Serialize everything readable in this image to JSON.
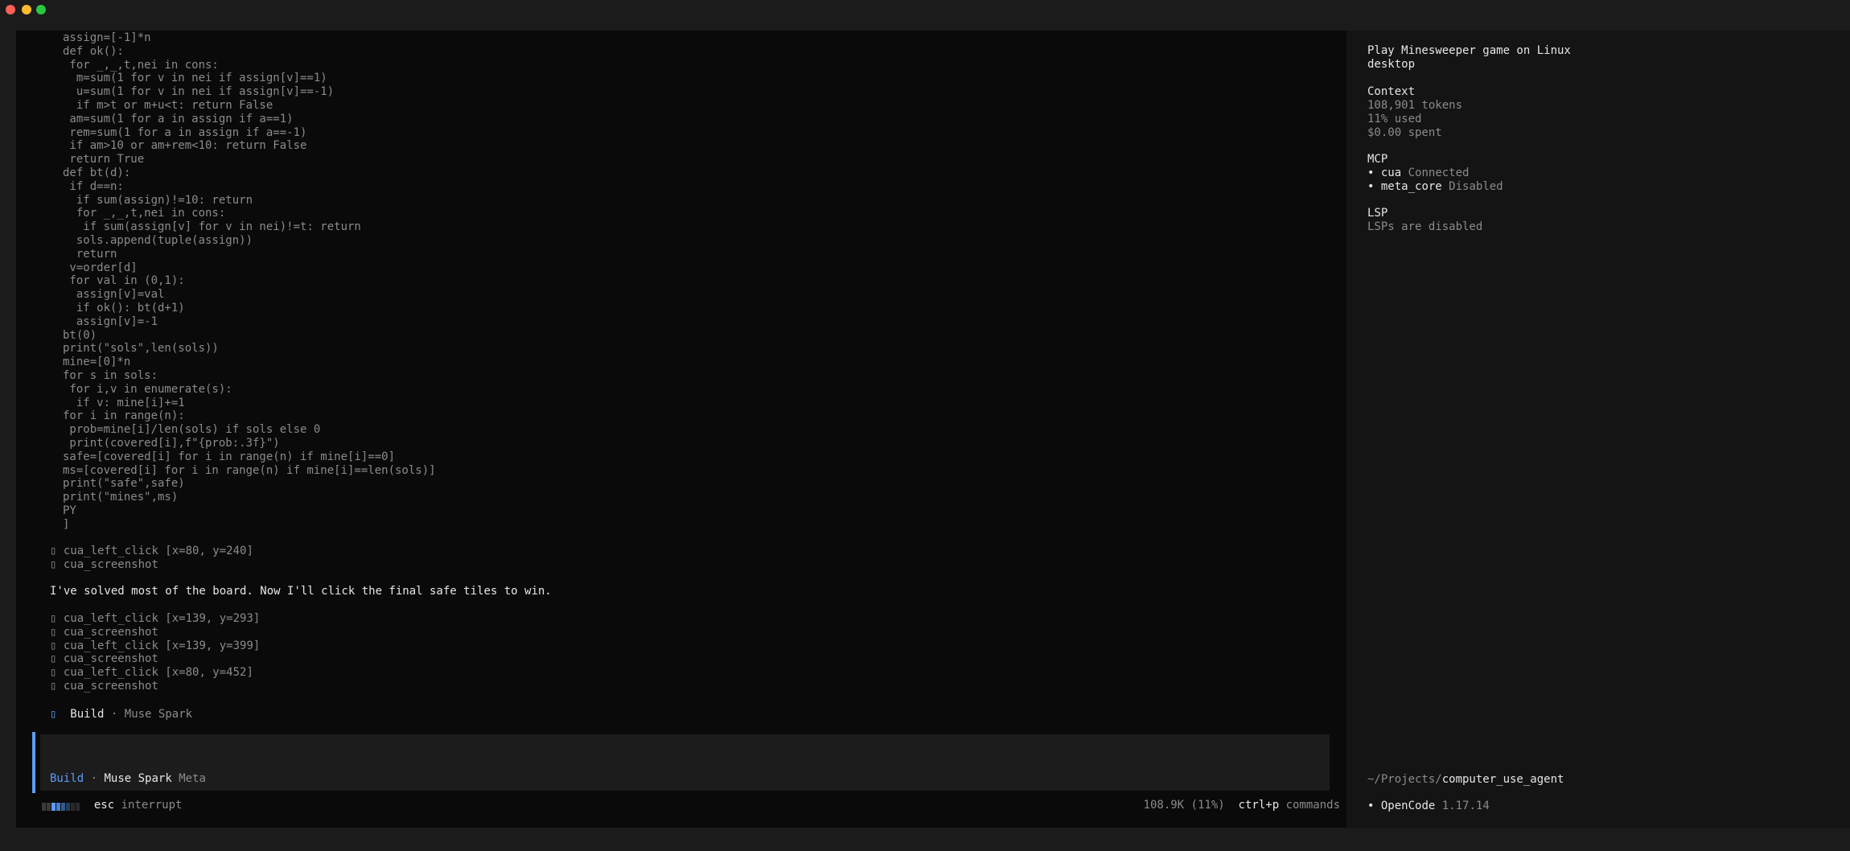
{
  "code_lines": [
    "assign=[-1]*n",
    "def ok():",
    " for _,_,t,nei in cons:",
    "  m=sum(1 for v in nei if assign[v]==1)",
    "  u=sum(1 for v in nei if assign[v]==-1)",
    "  if m>t or m+u<t: return False",
    " am=sum(1 for a in assign if a==1)",
    " rem=sum(1 for a in assign if a==-1)",
    " if am>10 or am+rem<10: return False",
    " return True",
    "def bt(d):",
    " if d==n:",
    "  if sum(assign)!=10: return",
    "  for _,_,t,nei in cons:",
    "   if sum(assign[v] for v in nei)!=t: return",
    "  sols.append(tuple(assign))",
    "  return",
    " v=order[d]",
    " for val in (0,1):",
    "  assign[v]=val",
    "  if ok(): bt(d+1)",
    "  assign[v]=-1",
    "bt(0)",
    "print(\"sols\",len(sols))",
    "mine=[0]*n",
    "for s in sols:",
    " for i,v in enumerate(s):",
    "  if v: mine[i]+=1",
    "for i in range(n):",
    " prob=mine[i]/len(sols) if sols else 0",
    " print(covered[i],f\"{prob:.3f}\")",
    "safe=[covered[i] for i in range(n) if mine[i]==0]",
    "ms=[covered[i] for i in range(n) if mine[i]==len(sols)]",
    "print(\"safe\",safe)",
    "print(\"mines\",ms)",
    "PY",
    "]"
  ],
  "tool_glyph": "▯",
  "tool_calls_1": [
    "cua_left_click [x=80, y=240]",
    "cua_screenshot"
  ],
  "assistant_message": "I've solved most of the board. Now I'll click the final safe tiles to win.",
  "tool_calls_2": [
    "cua_left_click [x=139, y=293]",
    "cua_screenshot",
    "cua_left_click [x=139, y=399]",
    "cua_screenshot",
    "cua_left_click [x=80, y=452]",
    "cua_screenshot"
  ],
  "build_status": {
    "glyph": "▯",
    "mode": "Build",
    "sep": "·",
    "model": "Muse Spark"
  },
  "input": {
    "placeholder": "",
    "mode": "Build",
    "sep": "·",
    "model": "Muse Spark",
    "provider": "Meta"
  },
  "footer": {
    "spinner_glyph": "▯▯",
    "esc_key": "esc",
    "esc_label": "interrupt",
    "tokens": "108.9K (11%)",
    "cmd_key": "ctrl+p",
    "cmd_label": "commands"
  },
  "sidebar": {
    "title": "Play Minesweeper game on Linux\ndesktop",
    "context_heading": "Context",
    "context_tokens": "108,901 tokens",
    "context_used": "11% used",
    "context_spent": "$0.00 spent",
    "mcp_heading": "MCP",
    "mcp_items": [
      {
        "name": "cua",
        "status": "Connected"
      },
      {
        "name": "meta_core",
        "status": "Disabled"
      }
    ],
    "lsp_heading": "LSP",
    "lsp_status": "LSPs are disabled",
    "path_prefix": "~/Projects/",
    "path_name": "computer_use_agent",
    "app_name": "OpenCode",
    "app_version": "1.17.14"
  },
  "colors": {
    "accent": "#5c9cf5",
    "bg": "#0a0a0a",
    "sidebar_bg": "#141414"
  }
}
